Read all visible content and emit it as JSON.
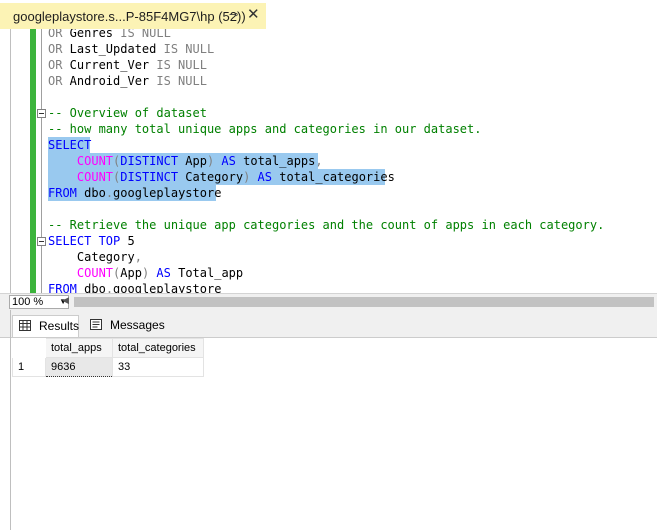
{
  "tab": {
    "title": "googleplaystore.s...P-85F4MG7\\hp (52))",
    "pin": "⊸",
    "close": "✕"
  },
  "code": [
    [
      {
        "t": "OR",
        "c": "gr"
      },
      {
        "t": " Genres ",
        "c": "tx"
      },
      {
        "t": "IS NULL",
        "c": "gr"
      }
    ],
    [
      {
        "t": "OR",
        "c": "gr"
      },
      {
        "t": " Last_Updated ",
        "c": "tx"
      },
      {
        "t": "IS NULL",
        "c": "gr"
      }
    ],
    [
      {
        "t": "OR",
        "c": "gr"
      },
      {
        "t": " Current_Ver ",
        "c": "tx"
      },
      {
        "t": "IS NULL",
        "c": "gr"
      }
    ],
    [
      {
        "t": "OR",
        "c": "gr"
      },
      {
        "t": " Android_Ver ",
        "c": "tx"
      },
      {
        "t": "IS NULL",
        "c": "gr"
      }
    ],
    [],
    [
      {
        "t": "-- Overview of dataset",
        "c": "cm"
      }
    ],
    [
      {
        "t": "-- how many total unique apps and categories in our dataset.",
        "c": "cm"
      }
    ],
    [
      {
        "t": "SELECT",
        "c": "kw"
      }
    ],
    [
      {
        "t": "    COUNT",
        "c": "fn"
      },
      {
        "t": "(",
        "c": "gr"
      },
      {
        "t": "DISTINCT",
        "c": "kw"
      },
      {
        "t": " App",
        "c": "tx"
      },
      {
        "t": ")",
        "c": "gr"
      },
      {
        "t": " AS",
        "c": "kw"
      },
      {
        "t": " total_apps",
        "c": "tx"
      },
      {
        "t": ",",
        "c": "gr"
      }
    ],
    [
      {
        "t": "    COUNT",
        "c": "fn"
      },
      {
        "t": "(",
        "c": "gr"
      },
      {
        "t": "DISTINCT",
        "c": "kw"
      },
      {
        "t": " Category",
        "c": "tx"
      },
      {
        "t": ")",
        "c": "gr"
      },
      {
        "t": " AS",
        "c": "kw"
      },
      {
        "t": " total_categories",
        "c": "tx"
      }
    ],
    [
      {
        "t": "FROM",
        "c": "kw"
      },
      {
        "t": " dbo",
        "c": "tx"
      },
      {
        "t": ".",
        "c": "gr"
      },
      {
        "t": "googleplaystore",
        "c": "tx"
      }
    ],
    [],
    [
      {
        "t": "-- Retrieve the unique app categories and the count of apps in each category.",
        "c": "cm"
      }
    ],
    [
      {
        "t": "SELECT",
        "c": "kw"
      },
      {
        "t": " TOP",
        "c": "kw"
      },
      {
        "t": " 5",
        "c": "tx"
      }
    ],
    [
      {
        "t": "    Category",
        "c": "tx"
      },
      {
        "t": ",",
        "c": "gr"
      }
    ],
    [
      {
        "t": "    COUNT",
        "c": "fn"
      },
      {
        "t": "(",
        "c": "gr"
      },
      {
        "t": "App",
        "c": "tx"
      },
      {
        "t": ")",
        "c": "gr"
      },
      {
        "t": " AS",
        "c": "kw"
      },
      {
        "t": " Total_app",
        "c": "tx"
      }
    ],
    [
      {
        "t": "FROM",
        "c": "kw"
      },
      {
        "t": " dbo",
        "c": "tx"
      },
      {
        "t": ".",
        "c": "gr"
      },
      {
        "t": "googleplaystore",
        "c": "tx"
      }
    ]
  ],
  "zoom": {
    "value": "100 %"
  },
  "results_tabs": [
    {
      "label": "Results"
    },
    {
      "label": "Messages"
    }
  ],
  "grid": {
    "columns": [
      "total_apps",
      "total_categories"
    ],
    "rows": [
      {
        "rownum": "1",
        "cells": [
          "9636",
          "33"
        ]
      }
    ]
  },
  "colors": {
    "tab_bg": "#fcf3b5",
    "selection": "#99c9ef",
    "keyword": "#0000ff",
    "function": "#ff00ff",
    "comment": "#008000"
  }
}
